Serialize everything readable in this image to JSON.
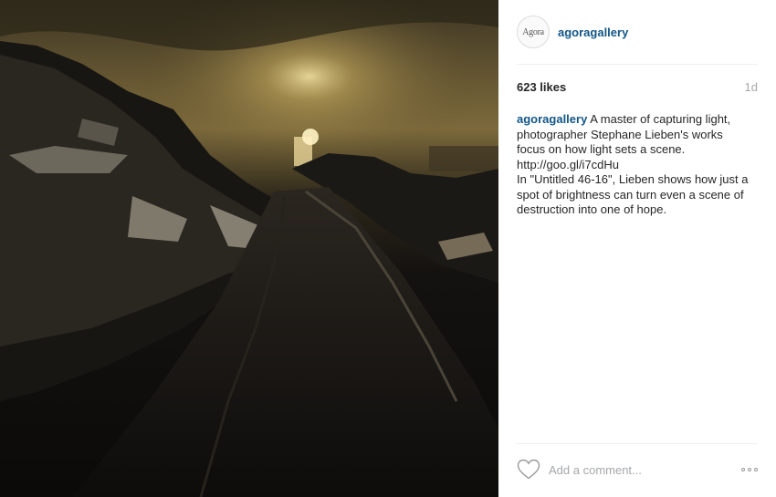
{
  "post": {
    "username": "agoragallery",
    "avatar_text": "Agora",
    "likes": "623 likes",
    "age": "1d",
    "caption": {
      "user": "agoragallery",
      "lines": [
        "A master of capturing light,",
        "photographer Stephane Lieben's works",
        "focus on how light sets a scene.",
        "http://goo.gl/i7cdHu",
        "In \"Untitled 46-16\", Lieben shows how just a",
        "spot of brightness can turn even a scene of",
        "destruction into one of hope."
      ]
    },
    "comment_placeholder": "Add a comment..."
  },
  "icons": {
    "like": "heart-outline-icon",
    "more": "ellipsis-icon"
  },
  "colors": {
    "username": "#125688",
    "text": "#262626",
    "muted": "#a5a7aa",
    "divider": "#efefef"
  }
}
